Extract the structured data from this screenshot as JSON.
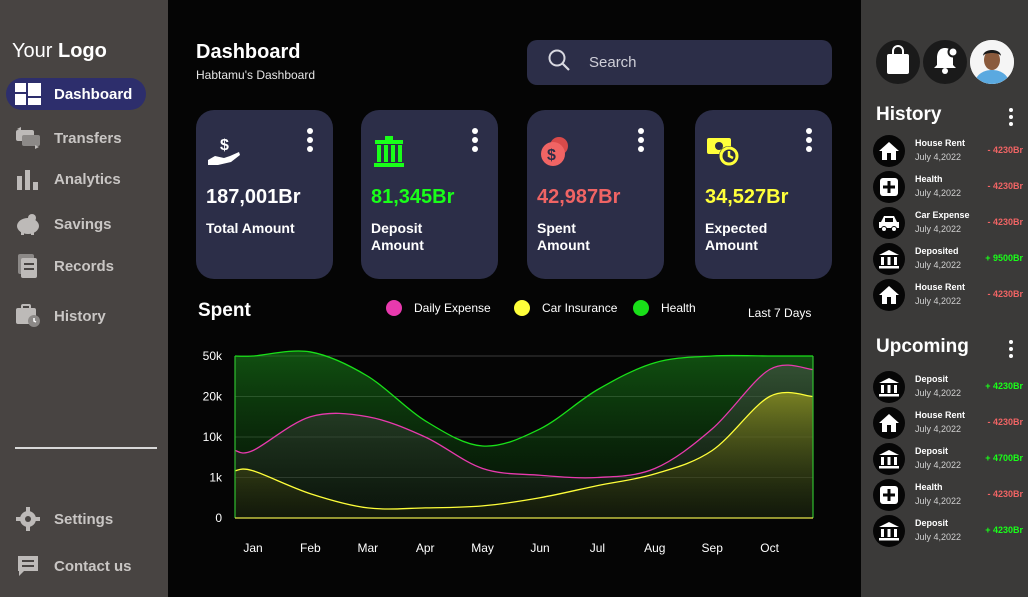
{
  "sidebar": {
    "logo_prefix": "Your",
    "logo_bold": "Logo",
    "items": [
      {
        "label": "Dashboard",
        "icon": "dashboard-icon"
      },
      {
        "label": "Transfers",
        "icon": "transfer-icon"
      },
      {
        "label": "Analytics",
        "icon": "analytics-icon"
      },
      {
        "label": "Savings",
        "icon": "piggy-bank-icon"
      },
      {
        "label": "Records",
        "icon": "records-icon"
      },
      {
        "label": "History",
        "icon": "history-icon"
      }
    ],
    "bottom_items": [
      {
        "label": "Settings",
        "icon": "gear-icon"
      },
      {
        "label": "Contact us",
        "icon": "message-icon"
      }
    ]
  },
  "header": {
    "title": "Dashboard",
    "subtitle": "Habtamu's Dashboard",
    "search_placeholder": "Search"
  },
  "cards": [
    {
      "amount": "187,001Br",
      "label": "Total Amount",
      "color": "#ffffff",
      "icon": "hand-money-icon"
    },
    {
      "amount": "81,345Br",
      "label": "Deposit Amount",
      "color": "#19ff19",
      "icon": "bank-building-icon"
    },
    {
      "amount": "42,987Br",
      "label": "Spent Amount",
      "color": "#f06464",
      "icon": "coins-icon"
    },
    {
      "amount": "34,527Br",
      "label": "Expected Amount",
      "color": "#ffff3a",
      "icon": "money-clock-icon"
    }
  ],
  "chart_section": {
    "title": "Spent",
    "range": "Last 7 Days",
    "legend": [
      {
        "name": "Daily Expense",
        "color": "#e83aae"
      },
      {
        "name": "Car Insurance",
        "color": "#ffff3a"
      },
      {
        "name": "Health",
        "color": "#19e019"
      }
    ]
  },
  "chart_data": {
    "type": "area",
    "categories": [
      "Jan",
      "Feb",
      "Mar",
      "Apr",
      "May",
      "Jun",
      "Jul",
      "Aug",
      "Sep",
      "Oct"
    ],
    "y_ticks": [
      "0",
      "1k",
      "10k",
      "20k",
      "50k"
    ],
    "y_scale": "non-linear (ticks 0, 1k, 10k, 20k, 50k evenly spaced)",
    "series": [
      {
        "name": "Health",
        "color": "#19e019",
        "values": [
          50000,
          52000,
          35000,
          14000,
          8000,
          12000,
          25000,
          45000,
          50000,
          50000
        ]
      },
      {
        "name": "Daily Expense",
        "color": "#e83aae",
        "values": [
          7000,
          15000,
          15000,
          10000,
          3000,
          1500,
          1000,
          3000,
          12000,
          40000
        ]
      },
      {
        "name": "Car Insurance",
        "color": "#ffff3a",
        "values": [
          2500,
          600,
          250,
          250,
          300,
          500,
          800,
          1800,
          7000,
          20000
        ]
      }
    ],
    "grid": true
  },
  "right_panel": {
    "icons": [
      "shopping-bag-icon",
      "bell-icon"
    ],
    "history_title": "History",
    "history": [
      {
        "name": "House Rent",
        "date": "July 4,2022",
        "amount": "- 4230Br",
        "type": "out",
        "icon": "home-icon"
      },
      {
        "name": "Health",
        "date": "July 4,2022",
        "amount": "- 4230Br",
        "type": "out",
        "icon": "health-plus-icon"
      },
      {
        "name": "Car Expense",
        "date": "July 4,2022",
        "amount": "- 4230Br",
        "type": "out",
        "icon": "car-icon"
      },
      {
        "name": "Deposited",
        "date": "July 4,2022",
        "amount": "+ 9500Br",
        "type": "in",
        "icon": "bank-icon"
      },
      {
        "name": "House Rent",
        "date": "July 4,2022",
        "amount": "- 4230Br",
        "type": "out",
        "icon": "home-icon"
      }
    ],
    "upcoming_title": "Upcoming",
    "upcoming": [
      {
        "name": "Deposit",
        "date": "July 4,2022",
        "amount": "+ 4230Br",
        "type": "in",
        "icon": "bank-icon"
      },
      {
        "name": "House Rent",
        "date": "July 4,2022",
        "amount": "- 4230Br",
        "type": "out",
        "icon": "home-icon"
      },
      {
        "name": "Deposit",
        "date": "July 4,2022",
        "amount": "+ 4700Br",
        "type": "in",
        "icon": "bank-icon"
      },
      {
        "name": "Health",
        "date": "July 4,2022",
        "amount": "- 4230Br",
        "type": "out",
        "icon": "health-plus-icon"
      },
      {
        "name": "Deposit",
        "date": "July 4,2022",
        "amount": "+ 4230Br",
        "type": "in",
        "icon": "bank-icon"
      }
    ],
    "colors": {
      "in": "#19ff19",
      "out": "#f06464"
    }
  }
}
